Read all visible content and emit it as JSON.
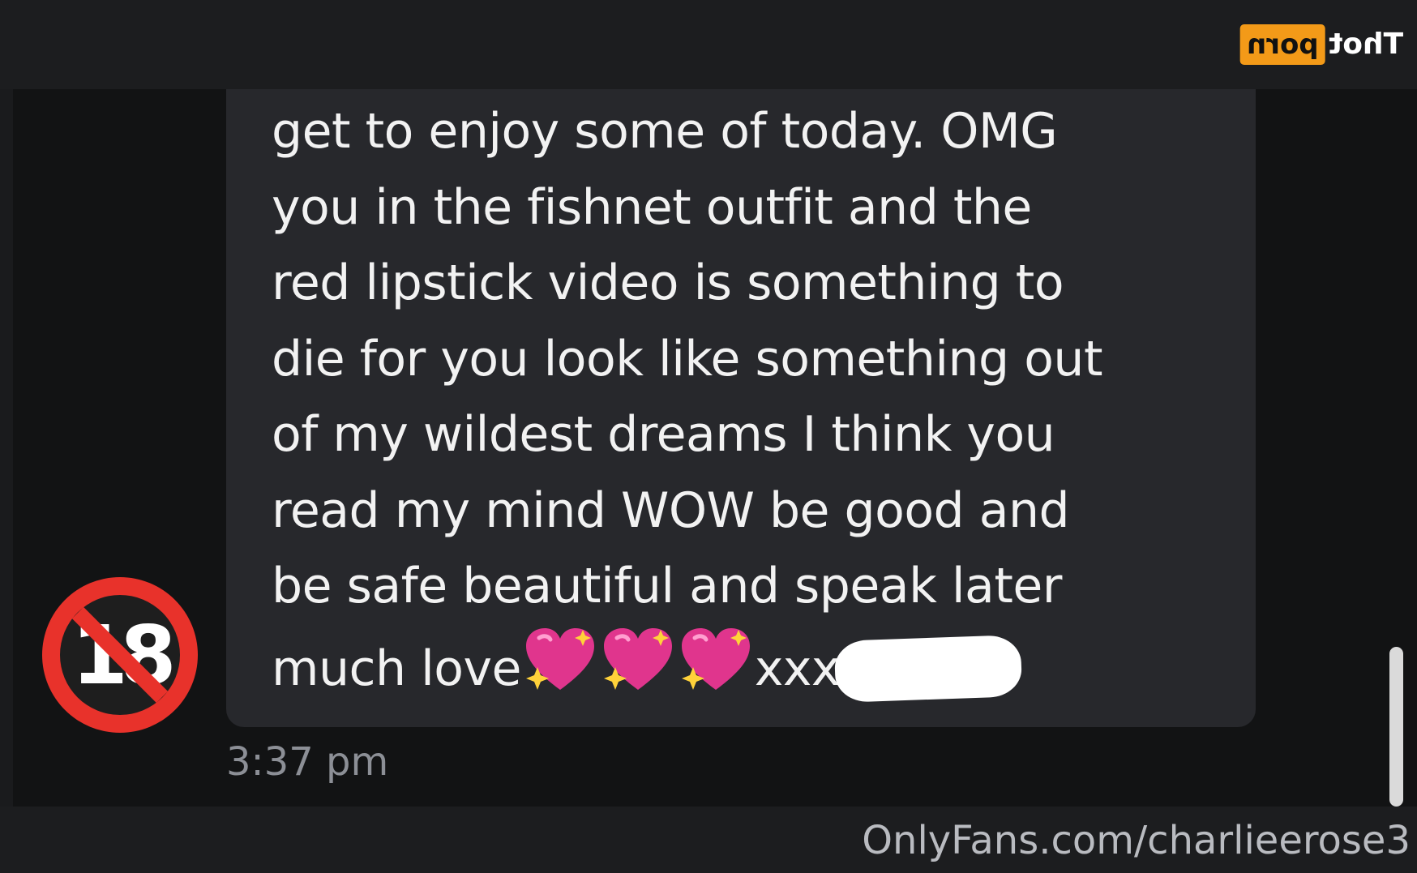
{
  "message": {
    "lines": [
      "get to enjoy some of today. OMG",
      "you in the fishnet outfit and the",
      "red lipstick video is something to",
      "die for you look like something out",
      "of my wildest dreams I think you",
      "read my mind WOW be good and",
      "be safe beautiful and speak later"
    ],
    "last_line_text": "much love",
    "last_line_suffix": "xxx",
    "emoji": "sparkling-heart",
    "emoji_count": 3
  },
  "timestamp": "3:37 pm",
  "avatar": {
    "icon": "no-one-under-eighteen-icon",
    "label": "18"
  },
  "logo": {
    "box_text": "porn",
    "text": "Thot"
  },
  "watermark": "OnlyFans.com/charlieerose3",
  "colors": {
    "background": "#1a1b1d",
    "chat_background": "#121314",
    "bubble": "#27282c",
    "message_text": "#f2f2f2",
    "timestamp_text": "#8c8f96",
    "emoji_heart": "#e0358d",
    "avatar_ring": "#e8322b",
    "logo_orange": "#f39a18",
    "watermark_text": "#b9bbc0"
  }
}
